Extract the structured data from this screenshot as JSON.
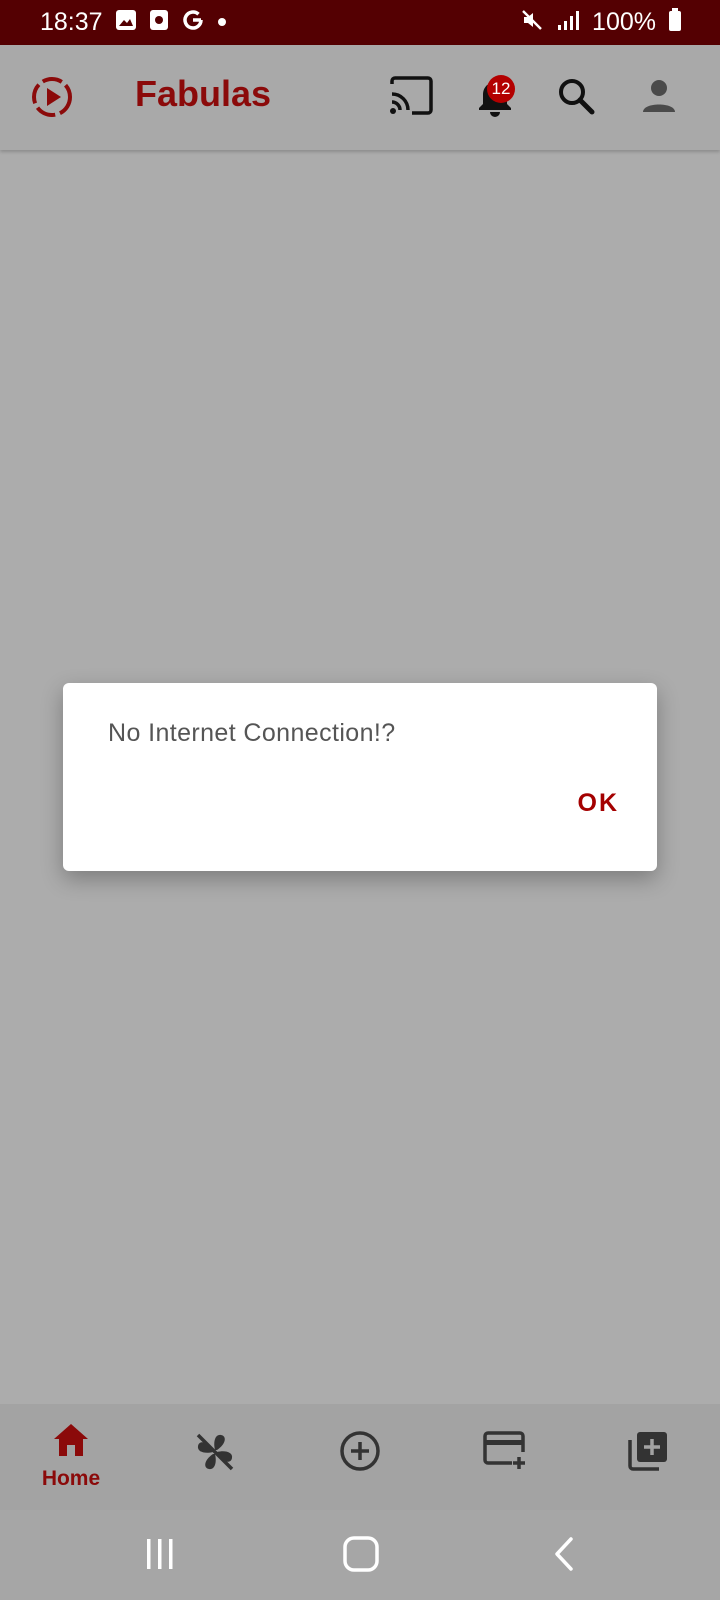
{
  "status_bar": {
    "time": "18:37",
    "battery": "100%",
    "icons": [
      "gallery-icon",
      "screen-record-icon",
      "google-icon",
      "dot-icon",
      "mute-icon",
      "signal-icon",
      "battery-icon"
    ]
  },
  "app_bar": {
    "title": "Fabulas",
    "notification_count": "12",
    "icons": [
      "app-logo-icon",
      "cast-icon",
      "bell-icon",
      "search-icon",
      "account-icon"
    ]
  },
  "dialog": {
    "message": "No Internet Connection!?",
    "ok_label": "OK"
  },
  "bottom_nav": {
    "items": [
      {
        "label": "Home",
        "icon": "home-icon",
        "active": true
      },
      {
        "label": "",
        "icon": "fan-off-icon"
      },
      {
        "label": "",
        "icon": "add-circle-icon"
      },
      {
        "label": "",
        "icon": "card-add-icon"
      },
      {
        "label": "",
        "icon": "library-add-icon"
      }
    ]
  },
  "colors": {
    "status_bar": "#540002",
    "accent": "#8b0a0a",
    "scrim": "#acacac",
    "badge": "#b30000"
  }
}
